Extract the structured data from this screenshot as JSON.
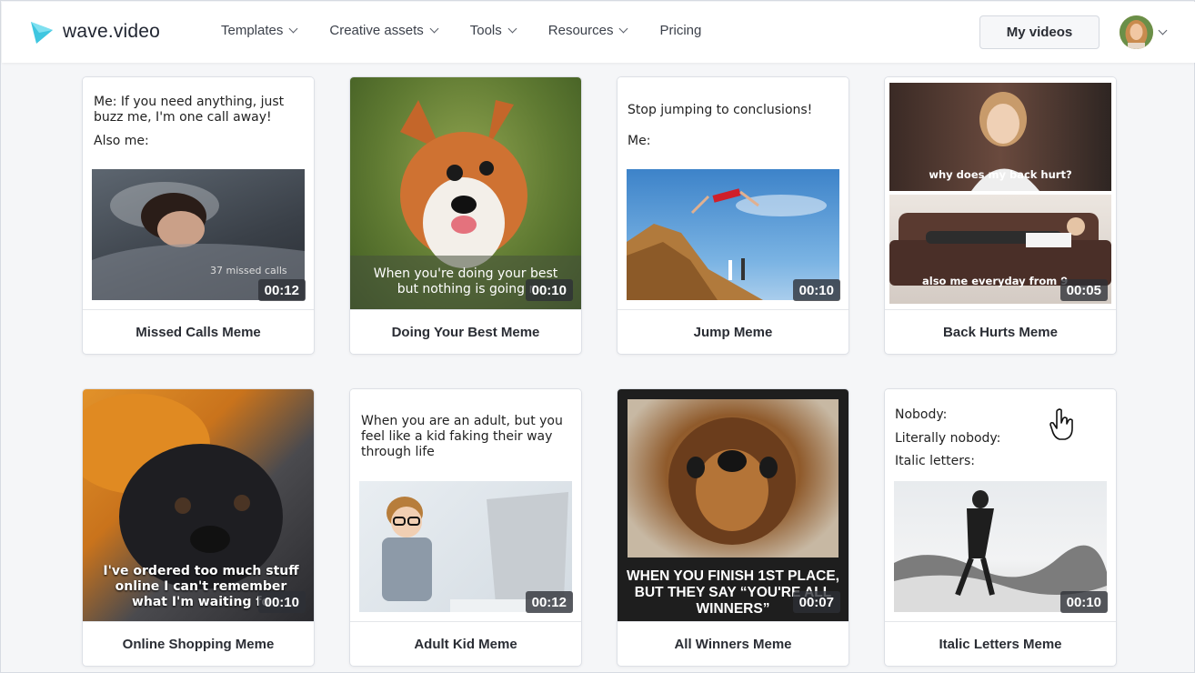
{
  "header": {
    "logo_text": "wave.video",
    "nav": [
      {
        "label": "Templates",
        "has_dropdown": true
      },
      {
        "label": "Creative assets",
        "has_dropdown": true
      },
      {
        "label": "Tools",
        "has_dropdown": true
      },
      {
        "label": "Resources",
        "has_dropdown": true
      },
      {
        "label": "Pricing",
        "has_dropdown": false
      }
    ],
    "my_videos_label": "My videos"
  },
  "cards": [
    {
      "title": "Missed Calls Meme",
      "duration": "00:12",
      "text_lines": [
        "Me: If you need anything, just buzz me, I'm one call away!",
        "Also me:"
      ],
      "caption": "37 missed calls"
    },
    {
      "title": "Doing Your Best Meme",
      "duration": "00:10",
      "caption": "When you're doing your best but nothing is going r"
    },
    {
      "title": "Jump Meme",
      "duration": "00:10",
      "text_lines": [
        "Stop jumping to conclusions!",
        "Me:"
      ]
    },
    {
      "title": "Back Hurts Meme",
      "duration": "00:05",
      "caption_top": "why does my back hurt?",
      "caption_bottom": "also me everyday from 9"
    },
    {
      "title": "Online Shopping Meme",
      "duration": "00:10",
      "caption": "I've ordered too much stuff online I can't remember what I'm waiting fo"
    },
    {
      "title": "Adult Kid Meme",
      "duration": "00:12",
      "text_lines": [
        "When you are an adult, but you feel like a kid faking their way through life"
      ]
    },
    {
      "title": "All Winners Meme",
      "duration": "00:07",
      "caption": "WHEN YOU FINISH 1ST PLACE, BUT THEY SAY “YOU'RE ALL WINNERS”"
    },
    {
      "title": "Italic Letters Meme",
      "duration": "00:10",
      "text_lines": [
        "Nobody:",
        "Literally nobody:",
        "Italic letters:"
      ]
    }
  ],
  "colors": {
    "brand": "#3ec6e0",
    "accent": "#1f2430"
  }
}
